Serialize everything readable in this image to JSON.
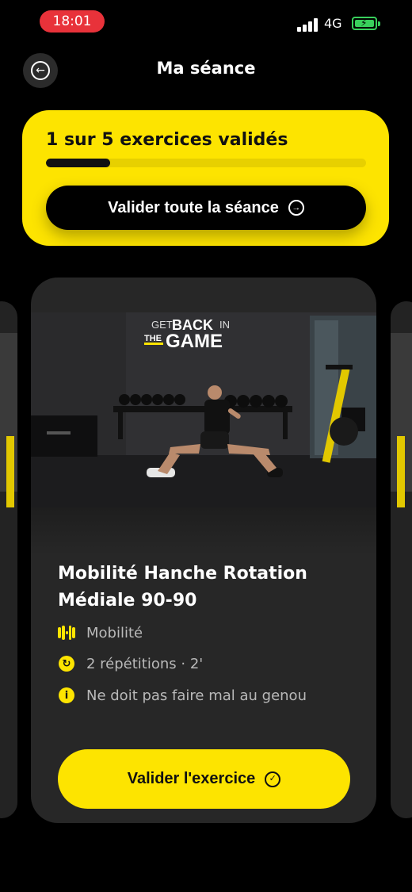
{
  "status_bar": {
    "time": "18:01",
    "network": "4G",
    "time_pill_color": "#e8323a",
    "battery_color": "#39d05c"
  },
  "header": {
    "title": "Ma séance",
    "back_icon": "arrow-left-circle-icon"
  },
  "progress": {
    "text": "1 sur 5 exercices validés",
    "completed": 1,
    "total": 5,
    "fraction": 0.2,
    "button_label": "Valider toute la séance",
    "button_icon": "arrow-right-circle-icon",
    "accent_color": "#fde400"
  },
  "exercise": {
    "media_logo": {
      "line1": "GET",
      "line2": "BACK",
      "line3": "IN",
      "line4": "THE",
      "line5": "GAME"
    },
    "title": "Mobilité Hanche Rotation Médiale 90-90",
    "category": "Mobilité",
    "category_icon": "dumbbell-icon",
    "reps": "2 répétitions · 2'",
    "reps_icon": "repeat-icon",
    "note": "Ne doit pas faire mal au genou",
    "note_icon": "info-icon",
    "button_label": "Valider l'exercice",
    "button_icon": "check-circle-icon"
  }
}
